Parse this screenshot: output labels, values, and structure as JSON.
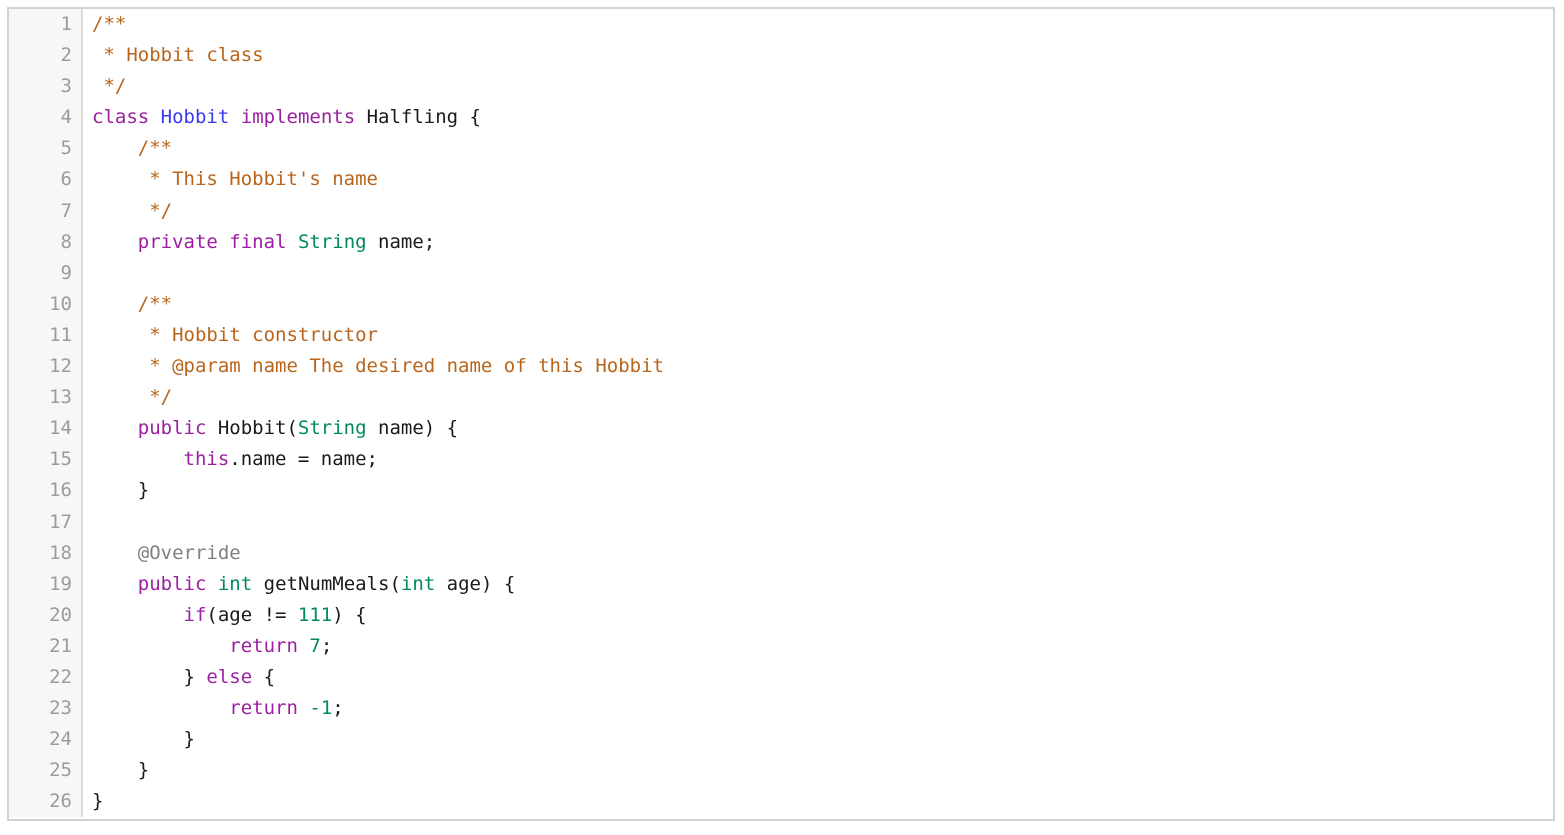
{
  "editor": {
    "language": "java",
    "theme": "light",
    "border_color": "#d2d2d2",
    "gutter_background": "#f7f7f7",
    "gutter_divider_color": "#dcdcdc",
    "line_number_color": "#9b9b9b",
    "background": "#ffffff",
    "first_line": 1,
    "last_line": 26,
    "total_lines": 26
  },
  "syntax_colors": {
    "comment": "#b8651b",
    "keyword": "#9b1fa0",
    "class_declaration": "#3a3ae8",
    "type": "#008a5e",
    "number": "#008a5e",
    "annotation": "#808080",
    "plain": "#1a1a1a"
  },
  "lines": [
    {
      "number": "1",
      "tokens": [
        {
          "t": "/**",
          "c": "comment"
        }
      ]
    },
    {
      "number": "2",
      "tokens": [
        {
          "t": " * Hobbit class",
          "c": "comment"
        }
      ]
    },
    {
      "number": "3",
      "tokens": [
        {
          "t": " */",
          "c": "comment"
        }
      ]
    },
    {
      "number": "4",
      "tokens": [
        {
          "t": "class",
          "c": "keyword"
        },
        {
          "t": " ",
          "c": "plain"
        },
        {
          "t": "Hobbit",
          "c": "class_declaration"
        },
        {
          "t": " ",
          "c": "plain"
        },
        {
          "t": "implements",
          "c": "keyword"
        },
        {
          "t": " Halfling {",
          "c": "plain"
        }
      ]
    },
    {
      "number": "5",
      "tokens": [
        {
          "t": "    /**",
          "c": "comment"
        }
      ]
    },
    {
      "number": "6",
      "tokens": [
        {
          "t": "     * This Hobbit's name",
          "c": "comment"
        }
      ]
    },
    {
      "number": "7",
      "tokens": [
        {
          "t": "     */",
          "c": "comment"
        }
      ]
    },
    {
      "number": "8",
      "tokens": [
        {
          "t": "    ",
          "c": "plain"
        },
        {
          "t": "private final",
          "c": "keyword"
        },
        {
          "t": " ",
          "c": "plain"
        },
        {
          "t": "String",
          "c": "type"
        },
        {
          "t": " name;",
          "c": "plain"
        }
      ]
    },
    {
      "number": "9",
      "tokens": [
        {
          "t": "",
          "c": "plain"
        }
      ]
    },
    {
      "number": "10",
      "tokens": [
        {
          "t": "    /**",
          "c": "comment"
        }
      ]
    },
    {
      "number": "11",
      "tokens": [
        {
          "t": "     * Hobbit constructor",
          "c": "comment"
        }
      ]
    },
    {
      "number": "12",
      "tokens": [
        {
          "t": "     * @param name The desired name of this Hobbit",
          "c": "comment"
        }
      ]
    },
    {
      "number": "13",
      "tokens": [
        {
          "t": "     */",
          "c": "comment"
        }
      ]
    },
    {
      "number": "14",
      "tokens": [
        {
          "t": "    ",
          "c": "plain"
        },
        {
          "t": "public",
          "c": "keyword"
        },
        {
          "t": " Hobbit(",
          "c": "plain"
        },
        {
          "t": "String",
          "c": "type"
        },
        {
          "t": " name) {",
          "c": "plain"
        }
      ]
    },
    {
      "number": "15",
      "tokens": [
        {
          "t": "        ",
          "c": "plain"
        },
        {
          "t": "this",
          "c": "keyword"
        },
        {
          "t": ".name = name;",
          "c": "plain"
        }
      ]
    },
    {
      "number": "16",
      "tokens": [
        {
          "t": "    }",
          "c": "plain"
        }
      ]
    },
    {
      "number": "17",
      "tokens": [
        {
          "t": "",
          "c": "plain"
        }
      ]
    },
    {
      "number": "18",
      "tokens": [
        {
          "t": "    @Override",
          "c": "annotation"
        }
      ]
    },
    {
      "number": "19",
      "tokens": [
        {
          "t": "    ",
          "c": "plain"
        },
        {
          "t": "public",
          "c": "keyword"
        },
        {
          "t": " ",
          "c": "plain"
        },
        {
          "t": "int",
          "c": "type"
        },
        {
          "t": " getNumMeals(",
          "c": "plain"
        },
        {
          "t": "int",
          "c": "type"
        },
        {
          "t": " age) {",
          "c": "plain"
        }
      ]
    },
    {
      "number": "20",
      "tokens": [
        {
          "t": "        ",
          "c": "plain"
        },
        {
          "t": "if",
          "c": "keyword"
        },
        {
          "t": "(age != ",
          "c": "plain"
        },
        {
          "t": "111",
          "c": "number"
        },
        {
          "t": ") {",
          "c": "plain"
        }
      ]
    },
    {
      "number": "21",
      "tokens": [
        {
          "t": "            ",
          "c": "plain"
        },
        {
          "t": "return",
          "c": "keyword"
        },
        {
          "t": " ",
          "c": "plain"
        },
        {
          "t": "7",
          "c": "number"
        },
        {
          "t": ";",
          "c": "plain"
        }
      ]
    },
    {
      "number": "22",
      "tokens": [
        {
          "t": "        } ",
          "c": "plain"
        },
        {
          "t": "else",
          "c": "keyword"
        },
        {
          "t": " {",
          "c": "plain"
        }
      ]
    },
    {
      "number": "23",
      "tokens": [
        {
          "t": "            ",
          "c": "plain"
        },
        {
          "t": "return",
          "c": "keyword"
        },
        {
          "t": " ",
          "c": "plain"
        },
        {
          "t": "-1",
          "c": "number"
        },
        {
          "t": ";",
          "c": "plain"
        }
      ]
    },
    {
      "number": "24",
      "tokens": [
        {
          "t": "        }",
          "c": "plain"
        }
      ]
    },
    {
      "number": "25",
      "tokens": [
        {
          "t": "    }",
          "c": "plain"
        }
      ]
    },
    {
      "number": "26",
      "tokens": [
        {
          "t": "}",
          "c": "plain"
        }
      ]
    }
  ]
}
